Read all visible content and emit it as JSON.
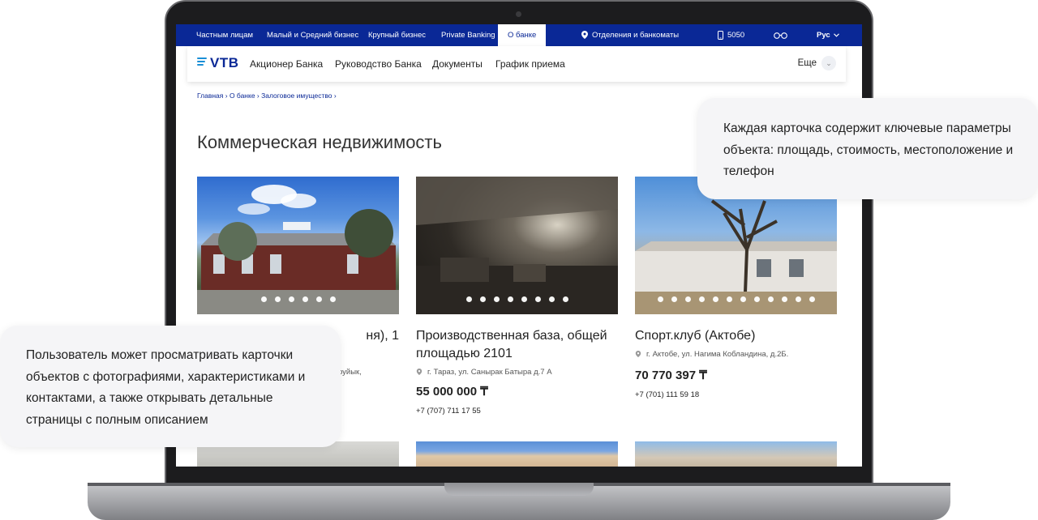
{
  "topbar": {
    "tabs": [
      "Частным лицам",
      "Малый и Средний бизнес",
      "Крупный бизнес",
      "Private Banking",
      "О банке"
    ],
    "branches": "Отделения и банкоматы",
    "phone": "5050",
    "language": "Рус"
  },
  "nav": {
    "logo": "VTB",
    "links": [
      "Акционер Банка",
      "Руководство Банка",
      "Документы",
      "График приема"
    ],
    "more": "Еще"
  },
  "breadcrumb": [
    "Главная",
    "О банке",
    "Залоговое имущество"
  ],
  "page_title": "Коммерческая недвижимость",
  "cards": [
    {
      "title": "ня), 1",
      "address": "руйык,",
      "price": "",
      "phone": ""
    },
    {
      "title": "Производственная база, общей площадью 2101",
      "address": "г. Тараз, ул. Санырак Батыра д.7 А",
      "price": "55 000 000 ₸",
      "phone": "+7 (707) 711 17 55"
    },
    {
      "title": "Спорт.клуб (Актобе)",
      "address": "г. Актобе, ул. Нагима Кобландина, д.2Б.",
      "price": "70 770 397 ₸",
      "phone": "+7 (701) 111 59 18"
    }
  ],
  "callouts": {
    "top": "Каждая карточка содержит ключевые параметры объекта: площадь, стоимость, местоположение и телефон",
    "bottom": "Пользователь может просматривать карточки объектов с фотографиями, характеристиками и контактами, а также открывать детальные страницы с полным описанием"
  },
  "colors": {
    "brand": "#0a2896",
    "logo_accent": "#1a8fd6"
  }
}
